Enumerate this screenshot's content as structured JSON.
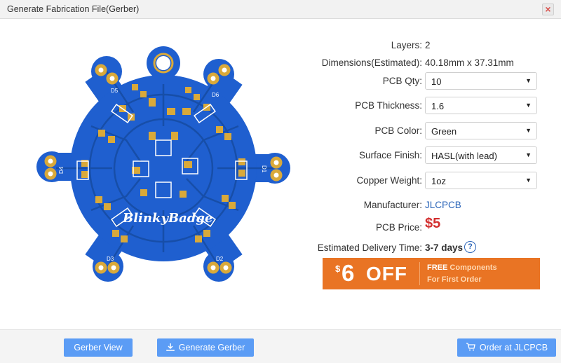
{
  "window": {
    "title": "Generate Fabrication File(Gerber)",
    "close_glyph": "×"
  },
  "board": {
    "silkscreen_text": "BlinkyBadge",
    "led_labels": [
      "D5",
      "D6",
      "D4",
      "D1",
      "D3",
      "D2"
    ]
  },
  "specs": {
    "layers": {
      "label": "Layers:",
      "value": "2"
    },
    "dimensions": {
      "label": "Dimensions(Estimated):",
      "value": "40.18mm x 37.31mm"
    },
    "pcb_qty": {
      "label": "PCB Qty:",
      "value": "10"
    },
    "pcb_thickness": {
      "label": "PCB Thickness:",
      "value": "1.6"
    },
    "pcb_color": {
      "label": "PCB Color:",
      "value": "Green"
    },
    "surface_finish": {
      "label": "Surface Finish:",
      "value": "HASL(with lead)"
    },
    "copper_weight": {
      "label": "Copper Weight:",
      "value": "1oz"
    },
    "manufacturer": {
      "label": "Manufacturer:",
      "value": "JLCPCB"
    },
    "pcb_price": {
      "label": "PCB Price:",
      "value": "$5"
    },
    "delivery": {
      "label": "Estimated Delivery Time:",
      "value": "3-7 days"
    }
  },
  "promo": {
    "dollar": "$",
    "amount": "6",
    "off": "OFF",
    "free": "FREE",
    "components": "Components",
    "first_order": "For First Order"
  },
  "footer": {
    "gerber_view": "Gerber View",
    "generate_gerber": "Generate Gerber",
    "order": "Order at JLCPCB"
  },
  "colors": {
    "board_blue": "#1f5fcf",
    "pad_gold": "#d9a93a",
    "price_red": "#d32f2f",
    "promo_orange": "#e97424",
    "button_blue": "#5b9cf5"
  }
}
